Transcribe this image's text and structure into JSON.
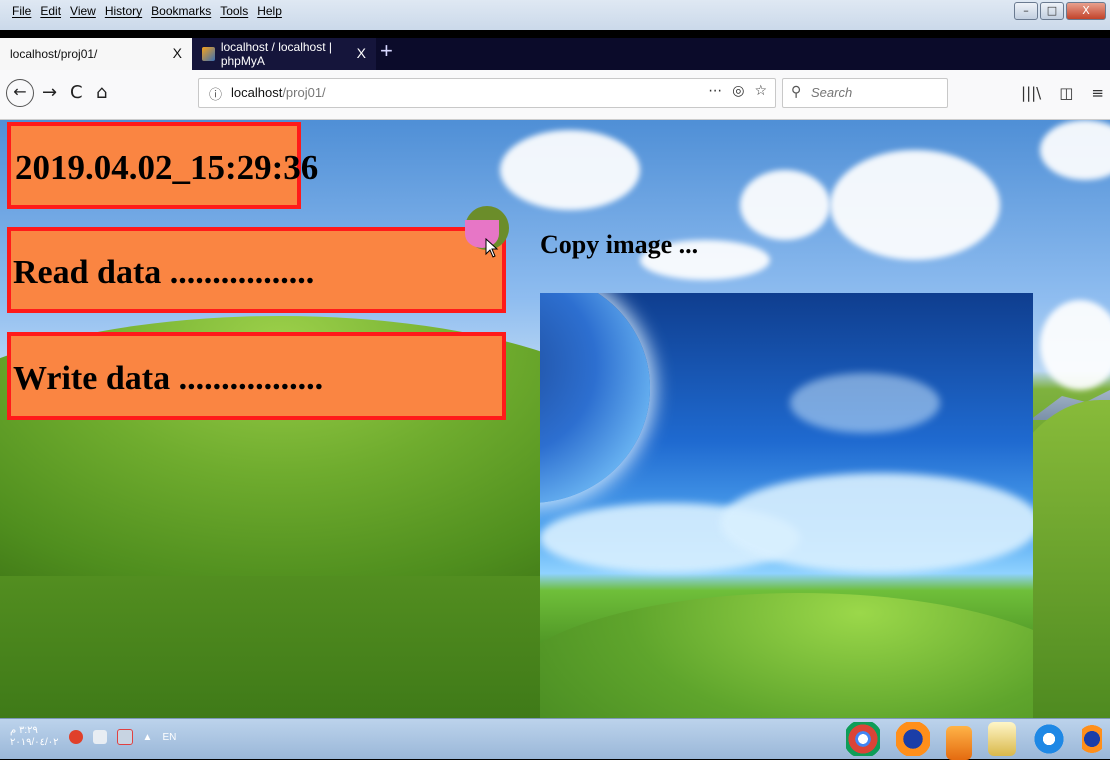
{
  "menu": [
    "File",
    "Edit",
    "View",
    "History",
    "Bookmarks",
    "Tools",
    "Help"
  ],
  "window_controls": {
    "minimize": "–",
    "maximize": "□",
    "close": "X"
  },
  "tabs": [
    {
      "title": "localhost/proj01/",
      "close": "X",
      "active": true
    },
    {
      "title": "localhost / localhost | phpMyA",
      "close": "X",
      "active": false
    }
  ],
  "new_tab": "+",
  "nav": {
    "back": "←",
    "forward": "→",
    "reload": "C",
    "home": "⌂",
    "info_icon": "ⓘ",
    "url_host": "localhost",
    "url_path": "/proj01/",
    "page_actions": "⋯",
    "pocket": "◎",
    "bookmark_star": "☆",
    "search_icon": "⚲",
    "search_placeholder": "Search",
    "library": "|||\\",
    "sidebar": "◫",
    "menu": "≡"
  },
  "page": {
    "timestamp": "2019.04.02_15:29:36",
    "read_status": "Read data .................",
    "write_status": "Write data .................",
    "copy_label": "Copy image ..."
  },
  "taskbar": {
    "clock_time": "٣:٢٩ م",
    "clock_date": "٢٠١٩/٠٤/٠٢",
    "language": "EN",
    "tray_arrow": "▲"
  },
  "colors": {
    "status_box_fill": "#fa8542",
    "status_box_border": "#ff1a1a"
  }
}
